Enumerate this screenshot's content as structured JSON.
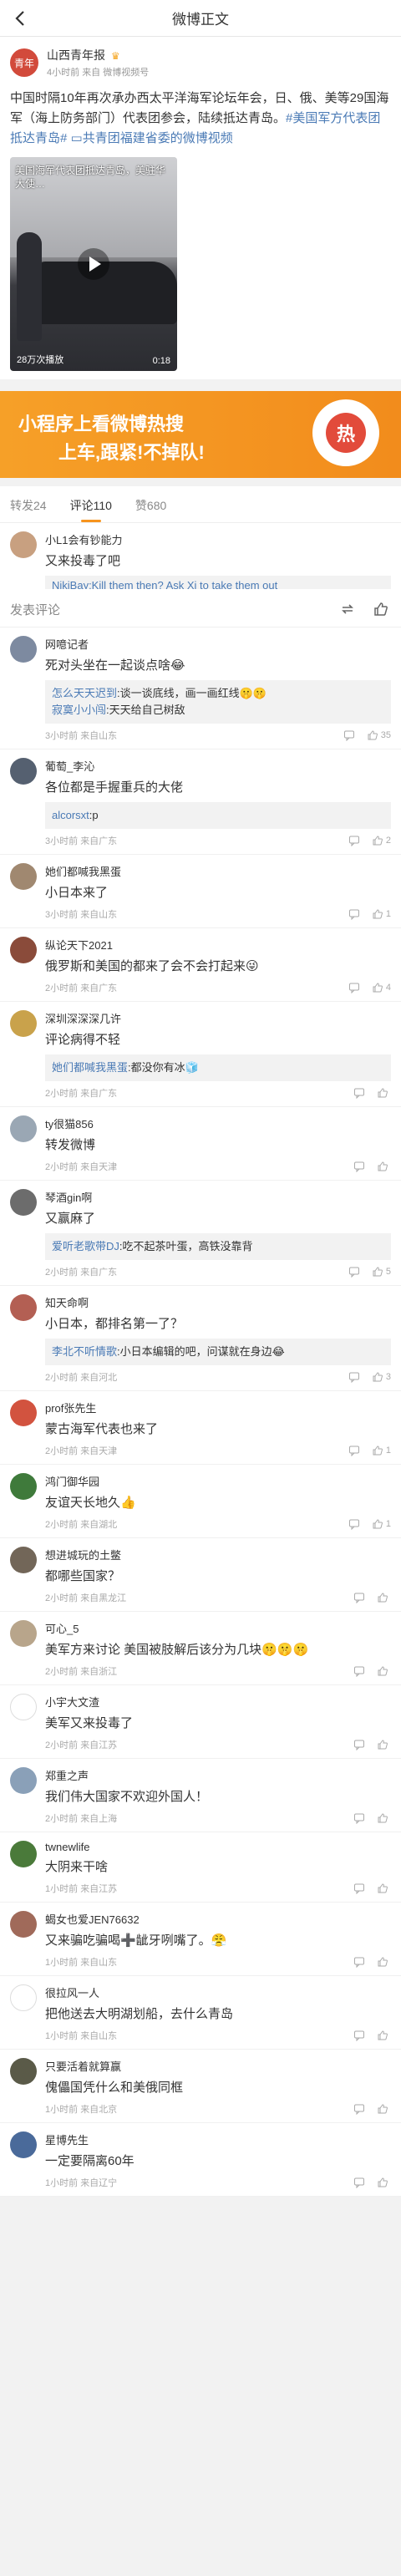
{
  "topbar": {
    "title": "微博正文"
  },
  "post": {
    "author": {
      "name": "山西青年报",
      "avatar_text": "青年",
      "time": "4小时前",
      "source": "来自 微博视频号"
    },
    "text": "中国时隔10年再次承办西太平洋海军论坛年会，日、俄、美等29国海军（海上防务部门）代表团参会，陆续抵达青岛。",
    "tag1": "#美国军方代表团抵达青岛#",
    "tag2": "共青团福建省委的微博视频",
    "video": {
      "overlay": "美国海军代表团抵达青岛，美驻华大使…",
      "views": "28万次播放",
      "duration": "0:18"
    }
  },
  "banner": {
    "line1": "小程序上看微博热搜",
    "line2": "上车,跟紧!不掉队!",
    "qr_text": "热"
  },
  "tabs": [
    {
      "label": "转发24",
      "active": false
    },
    {
      "label": "评论110",
      "active": true
    },
    {
      "label": "赞680",
      "active": false
    }
  ],
  "first_comment": {
    "name": "小L1会有钞能力",
    "text": "又来投毒了吧",
    "reply_partial": "NikiBay:Kill them then? Ask Xi to take them out"
  },
  "dropdown": {
    "label": "发表评论"
  },
  "comments": [
    {
      "name": "网噫记者",
      "text": "死对头坐在一起谈点啥😂",
      "color": "#7d8aa0",
      "replies": [
        {
          "u": "怎么天天迟到",
          "t": ":谈一谈底线，画一画红线🤫🤫"
        },
        {
          "u": "寂寞小小闯",
          "t": ":天天给自己树敌"
        }
      ],
      "time": "3小时前",
      "from": "来自山东",
      "likes": "35"
    },
    {
      "name": "葡萄_李沁",
      "text": "各位都是手握重兵的大佬",
      "color": "#556070",
      "replies": [
        {
          "u": "alcorsxt",
          "t": ":p"
        }
      ],
      "time": "3小时前",
      "from": "来自广东",
      "likes": "2"
    },
    {
      "name": "她们都喊我黑蛋",
      "text": "小日本来了",
      "color": "#a08870",
      "replies": [],
      "time": "3小时前",
      "from": "来自山东",
      "likes": "1"
    },
    {
      "name": "纵论天下2021",
      "text": "俄罗斯和美国的都来了会不会打起来😜",
      "color": "#8a4b3a",
      "replies": [],
      "time": "2小时前",
      "from": "来自广东",
      "likes": "4"
    },
    {
      "name": "深圳深深深几许",
      "text": "评论病得不轻",
      "color": "#c9a24b",
      "replies": [
        {
          "u": "她们都喊我黑蛋",
          "t": ":都没你有冰🧊"
        }
      ],
      "time": "2小时前",
      "from": "来自广东",
      "likes": ""
    },
    {
      "name": "ty很猫856",
      "text": "转发微博",
      "color": "#9aa7b4",
      "replies": [],
      "time": "2小时前",
      "from": "来自天津",
      "likes": ""
    },
    {
      "name": "琴酒gin啊",
      "text": "又赢麻了",
      "color": "#6c6c6c",
      "replies": [
        {
          "u": "爱听老歌带DJ",
          "t": ":吃不起茶叶蛋，高铁没靠背"
        }
      ],
      "time": "2小时前",
      "from": "来自广东",
      "likes": "5"
    },
    {
      "name": "知天命啊",
      "text": "小日本，都排名第一了？",
      "color": "#b35f53",
      "replies": [
        {
          "u": "李北不听情歌",
          "t": ":小日本编辑的吧，问谋就在身边😂"
        }
      ],
      "time": "2小时前",
      "from": "来自河北",
      "likes": "3"
    },
    {
      "name": "prof张先生",
      "text": "蒙古海军代表也来了",
      "color": "#d2533f",
      "replies": [],
      "time": "2小时前",
      "from": "来自天津",
      "likes": "1"
    },
    {
      "name": "鸿门御华园",
      "text": "友谊天长地久👍",
      "color": "#3f7a3b",
      "replies": [],
      "time": "2小时前",
      "from": "来自湖北",
      "likes": "1"
    },
    {
      "name": "想进城玩的土鳖",
      "text": "都哪些国家？",
      "color": "#726658",
      "replies": [],
      "time": "2小时前",
      "from": "来自黑龙江",
      "likes": ""
    },
    {
      "name": "可心_5",
      "text": "美军方来讨论 美国被肢解后该分为几块🤫🤫🤫",
      "color": "#b8a58b",
      "replies": [],
      "time": "2小时前",
      "from": "来自浙江",
      "likes": ""
    },
    {
      "name": "小宇大文渣",
      "text": "美军又来投毒了",
      "color": "#ffffff",
      "replies": [],
      "time": "2小时前",
      "from": "来自江苏",
      "likes": ""
    },
    {
      "name": "郑重之声",
      "text": "我们伟大国家不欢迎外国人！",
      "color": "#8aa0b8",
      "replies": [],
      "time": "2小时前",
      "from": "来自上海",
      "likes": ""
    },
    {
      "name": "twnewlife",
      "text": "大阴来干啥",
      "color": "#4a7a3a",
      "replies": [],
      "time": "1小时前",
      "from": "来自江苏",
      "likes": ""
    },
    {
      "name": "蝎女也爱JEN76632",
      "text": "又来骗吃骗喝➕龇牙咧嘴了。😤",
      "color": "#a06a5a",
      "replies": [],
      "time": "1小时前",
      "from": "来自山东",
      "likes": ""
    },
    {
      "name": "很拉风一人",
      "text": "把他送去大明湖划船，去什么青岛",
      "color": "#ffffff",
      "replies": [],
      "time": "1小时前",
      "from": "来自山东",
      "likes": ""
    },
    {
      "name": "只要活着就算赢",
      "text": "傀儡国凭什么和美俄同框",
      "color": "#5a5a48",
      "replies": [],
      "time": "1小时前",
      "from": "来自北京",
      "likes": ""
    },
    {
      "name": "星博先生",
      "text": "一定要隔离60年",
      "color": "#4a6a9a",
      "replies": [],
      "time": "1小时前",
      "from": "来自辽宁",
      "likes": ""
    }
  ]
}
